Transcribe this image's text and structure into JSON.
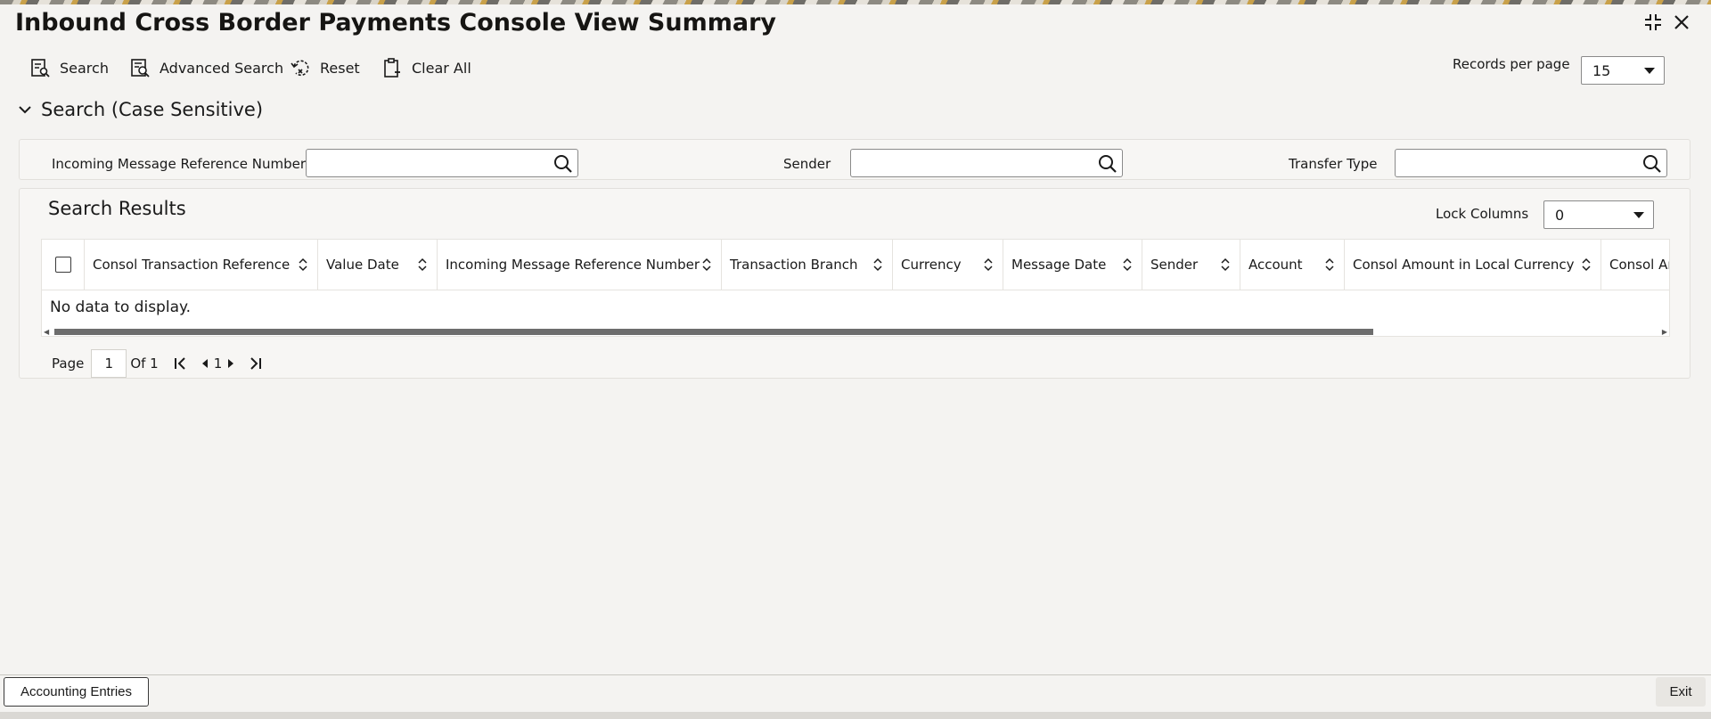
{
  "window": {
    "title": "Inbound Cross Border Payments Console View Summary"
  },
  "toolbar": {
    "search_label": "Search",
    "advanced_search_label": "Advanced Search",
    "reset_label": "Reset",
    "clear_all_label": "Clear All",
    "records_per_page_label": "Records per page",
    "records_per_page_value": "15"
  },
  "search_section": {
    "title": "Search (Case Sensitive)",
    "fields": {
      "incoming_ref_label": "Incoming Message Reference Number",
      "incoming_ref_value": "",
      "sender_label": "Sender",
      "sender_value": "",
      "transfer_type_label": "Transfer Type",
      "transfer_type_value": ""
    }
  },
  "results": {
    "title": "Search Results",
    "lock_columns_label": "Lock Columns",
    "lock_columns_value": "0",
    "columns": [
      "Consol Transaction Reference",
      "Value Date",
      "Incoming Message Reference Number",
      "Transaction Branch",
      "Currency",
      "Message Date",
      "Sender",
      "Account",
      "Consol Amount in Local Currency",
      "Consol Am"
    ],
    "empty_message": "No data to display."
  },
  "pager": {
    "page_label": "Page",
    "current_page": "1",
    "of_label": "Of 1",
    "page_link": "1"
  },
  "footer": {
    "accounting_entries_label": "Accounting Entries",
    "exit_label": "Exit"
  }
}
